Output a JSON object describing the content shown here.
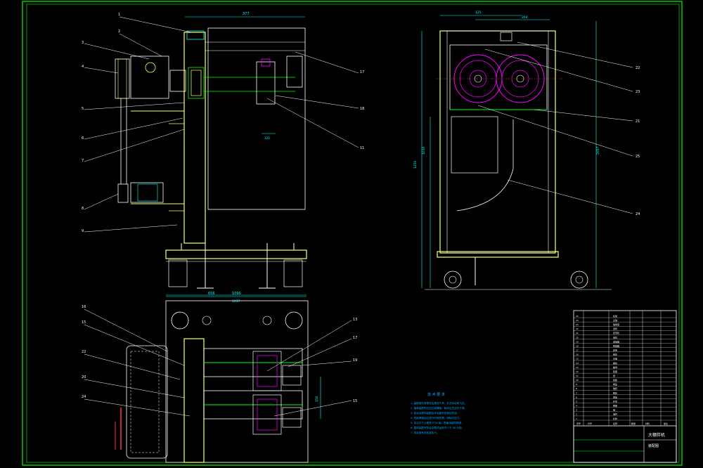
{
  "colors": {
    "background": "#000000",
    "border": "#00ff00",
    "frame": "#ffff66",
    "outline": "#ffffff",
    "dimension": "#00ffff",
    "centerline": "#ff3333",
    "pulley": "#ff00ff",
    "gear": "#00ccff",
    "notes": "#00aaff"
  },
  "front_view": {
    "dims": [
      "377",
      "1090",
      "120",
      "656"
    ],
    "callouts": [
      "1",
      "2",
      "3",
      "4",
      "5",
      "6",
      "7",
      "8",
      "9",
      "17",
      "18",
      "11"
    ]
  },
  "side_view": {
    "dims": [
      "125",
      "264",
      "1030",
      "1250",
      "2057"
    ],
    "callouts": [
      "22",
      "23",
      "21",
      "25",
      "24"
    ]
  },
  "top_view": {
    "dims": [
      "1037",
      "150"
    ],
    "callouts": [
      "16",
      "15",
      "22",
      "20",
      "24",
      "13",
      "17",
      "19",
      "15"
    ]
  },
  "notes": {
    "title": "技 术 要 求",
    "lines": [
      "1. 装配前所有零件应清洗干净，并去除毛刺飞边。",
      "2. 轴承装配时应加注润滑脂，转动应灵活无卡滞。",
      "3. 各运动部件装配后手动盘车应转动灵活。",
      "4. 机架焊接后应进行时效处理，消除内应力。",
      "5. 未注尺寸公差按 IT14 级，表面涂装防锈漆。",
      "6. 整机装配完毕后空载试运转不少于 30 分钟。",
      "7. 其余按有关标准执行。"
    ]
  },
  "title_block": {
    "title": "大棚拌机",
    "subtitle": "装配图",
    "rows": [
      "25",
      "24",
      "23",
      "22",
      "21",
      "20",
      "19",
      "18",
      "17",
      "16",
      "15",
      "14",
      "13",
      "12",
      "11",
      "10",
      "9",
      "8",
      "7",
      "6",
      "5",
      "4",
      "3",
      "2",
      "1"
    ],
    "part_names": [
      "机架",
      "主轴",
      "轴承座",
      "滚筒",
      "皮带轮",
      "电机",
      "减速器",
      "联轴器",
      "皮带",
      "链轮",
      "支座",
      "螺栓",
      "螺母",
      "垫圈",
      "键",
      "挡板",
      "端盖",
      "轴套",
      "脚轮",
      "底板",
      "护罩",
      "弹簧",
      "销",
      "油杯",
      "标牌"
    ],
    "header": [
      "序号",
      "代号",
      "名称",
      "数量",
      "材料",
      "备注"
    ]
  }
}
